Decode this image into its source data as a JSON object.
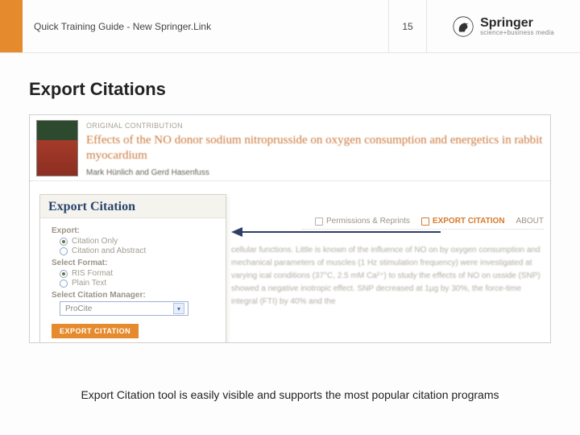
{
  "header": {
    "title": "Quick Training Guide -  New Springer.Link",
    "page_number": "15",
    "brand": "Springer",
    "tagline": "science+business media"
  },
  "slide_title": "Export Citations",
  "article": {
    "type_label": "ORIGINAL CONTRIBUTION",
    "title": "Effects of the NO donor sodium nitroprusside on oxygen consumption and energetics in rabbit myocardium",
    "authors": "Mark Hünlich and Gerd Hasenfuss"
  },
  "popover": {
    "title": "Export Citation",
    "export_label": "Export:",
    "export_options": [
      "Citation Only",
      "Citation and Abstract"
    ],
    "export_selected": 0,
    "format_label": "Select Format:",
    "format_options": [
      "RIS Format",
      "Plain Text"
    ],
    "format_selected": 0,
    "manager_label": "Select Citation Manager:",
    "manager_value": "ProCite",
    "button": "EXPORT CITATION"
  },
  "link_row": {
    "permissions": "Permissions & Reprints",
    "export": "EXPORT CITATION",
    "about": "ABOUT"
  },
  "abstract_stub": "cellular functions. Little is known of the influence of NO on by oxygen consumption and mechanical parameters of muscles (1 Hz stimulation frequency) were investigated at varying ical conditions (37°C, 2.5 mM Ca²⁺) to study the effects of NO on usside (SNP) showed a negative inotropic effect. SNP decreased at 1µg by 30%, the force-time integral (FTI) by 40% and the",
  "caption": "Export Citation tool is easily visible and supports the most popular citation programs"
}
